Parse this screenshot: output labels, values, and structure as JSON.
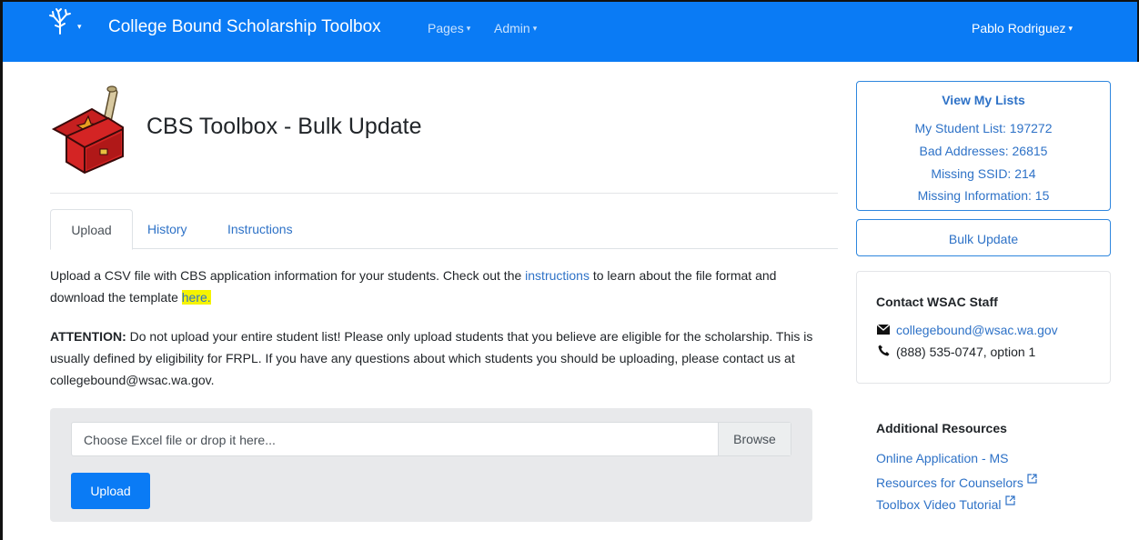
{
  "navbar": {
    "brand_title": "College Bound Scholarship Toolbox",
    "brand_caret": "▾",
    "pages_label": "Pages",
    "admin_label": "Admin",
    "user_name": "Pablo Rodriguez",
    "caret": "▾",
    "bg_color": "#0a7bf5"
  },
  "header": {
    "title": "CBS Toolbox - Bulk Update",
    "logo_icon": "toolbox-icon"
  },
  "tabs": [
    {
      "label": "Upload",
      "active": true
    },
    {
      "label": "History",
      "active": false
    },
    {
      "label": "Instructions",
      "active": false
    }
  ],
  "intro": {
    "text_before": "Upload a CSV file with CBS application information for your students. Check out the ",
    "instructions_link": "instructions",
    "text_middle": " to learn about the file format and download the template ",
    "here_link": "here.",
    "highlight_color": "#f5f300"
  },
  "attention": {
    "label": "ATTENTION:",
    "text": " Do not upload your entire student list! Please only upload students that you believe are eligible for the scholarship. This is usually defined by eligibility for FRPL. If you have any questions about which students you should be uploading, please contact us at collegebound@wsac.wa.gov."
  },
  "upload": {
    "file_placeholder": "Choose Excel file or drop it here...",
    "browse_label": "Browse",
    "upload_label": "Upload"
  },
  "sidebar": {
    "lists_title": "View My Lists",
    "lists": [
      "My Student List: 197272",
      "Bad Addresses: 26815",
      "Missing SSID: 214",
      "Missing Information: 15"
    ],
    "bulk_update_label": "Bulk Update",
    "contact_title": "Contact WSAC Staff",
    "contact_email": "collegebound@wsac.wa.gov",
    "contact_phone": "(888) 535-0747, option 1",
    "resources_title": "Additional Resources",
    "resources": [
      "Online Application - MS",
      "Resources for Counselors",
      "Toolbox Video Tutorial"
    ]
  }
}
